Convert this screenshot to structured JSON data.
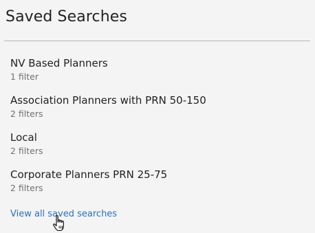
{
  "panel": {
    "title": "Saved Searches",
    "items": [
      {
        "name": "NV Based Planners",
        "count": "1 filter"
      },
      {
        "name": "Association Planners with PRN 50-150",
        "count": "2 filters"
      },
      {
        "name": "Local",
        "count": "2 filters"
      },
      {
        "name": "Corporate Planners PRN 25-75",
        "count": "2 filters"
      }
    ],
    "view_all_label": "View all saved searches"
  },
  "colors": {
    "link": "#2a6fbd",
    "background": "#f4f4f4",
    "secondary_text": "#707070"
  },
  "icons": {
    "cursor": "hand-pointer-icon"
  }
}
